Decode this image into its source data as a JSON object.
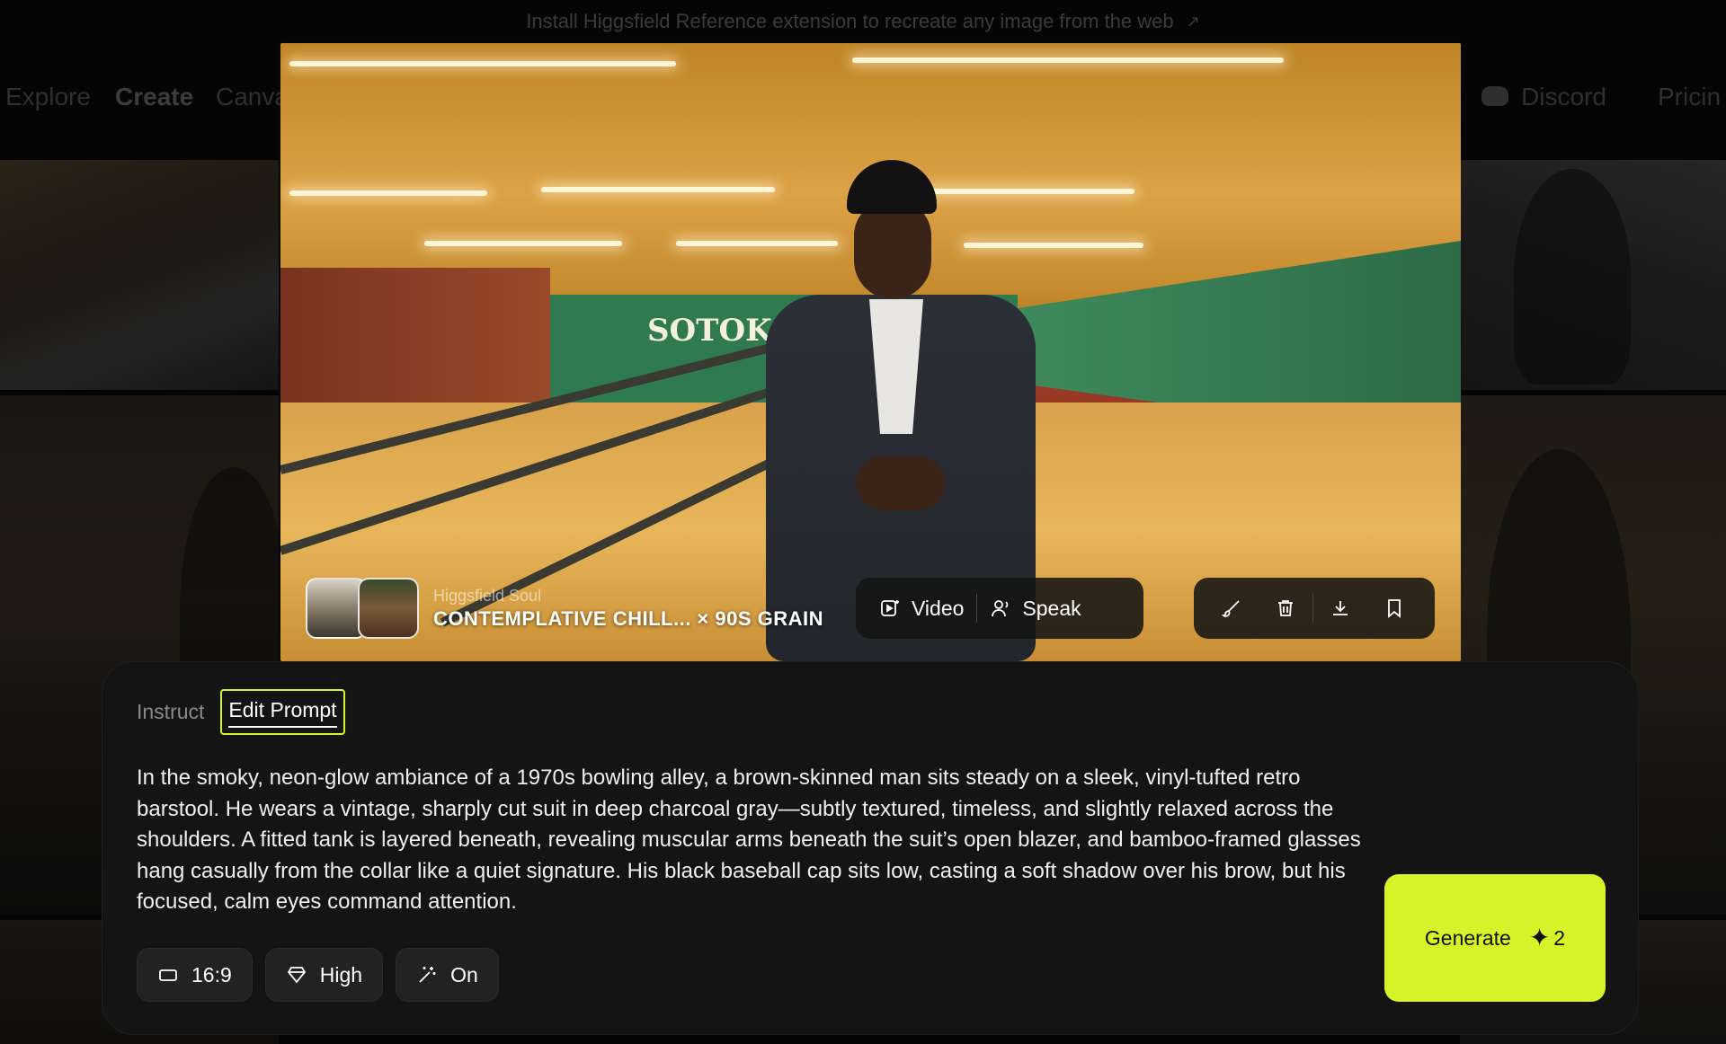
{
  "banner": {
    "text": "Install Higgsfield Reference extension to recreate any image from the web",
    "arrow": "↗"
  },
  "nav": {
    "explore": "Explore",
    "create": "Create",
    "canvas": "Canva",
    "discord": "Discord",
    "pricing": "Pricin"
  },
  "hero": {
    "sign_text": "SOTOK",
    "meta_label": "Higgsfield Soul",
    "meta_title": "CONTEMPLATIVE CHILL... × 90S GRAIN",
    "actions": {
      "video": "Video",
      "speak": "Speak"
    },
    "tool_icons": [
      "brush-icon",
      "trash-icon",
      "download-icon",
      "bookmark-icon"
    ]
  },
  "panel": {
    "tabs": [
      "Instruct",
      "Edit Prompt"
    ],
    "active_tab": "Edit Prompt",
    "prompt": "In the smoky, neon-glow ambiance of a 1970s bowling alley, a brown-skinned man sits steady on a sleek, vinyl-tufted retro barstool. He wears a vintage, sharply cut suit in deep charcoal gray—subtly textured, timeless, and slightly relaxed across the shoulders. A fitted tank is layered beneath, revealing muscular arms beneath the suit’s open blazer, and bamboo-framed glasses hang casually from the collar like a quiet signature. His black baseball cap sits low, casting a soft shadow over his brow, but his focused, calm eyes command attention.",
    "chips": {
      "aspect": "16:9",
      "quality": "High",
      "enhance": "On"
    },
    "generate": {
      "label": "Generate",
      "cost": "2"
    }
  },
  "colors": {
    "accent": "#d6f32a",
    "panel_bg": "#141414",
    "chip_bg": "#222222"
  }
}
